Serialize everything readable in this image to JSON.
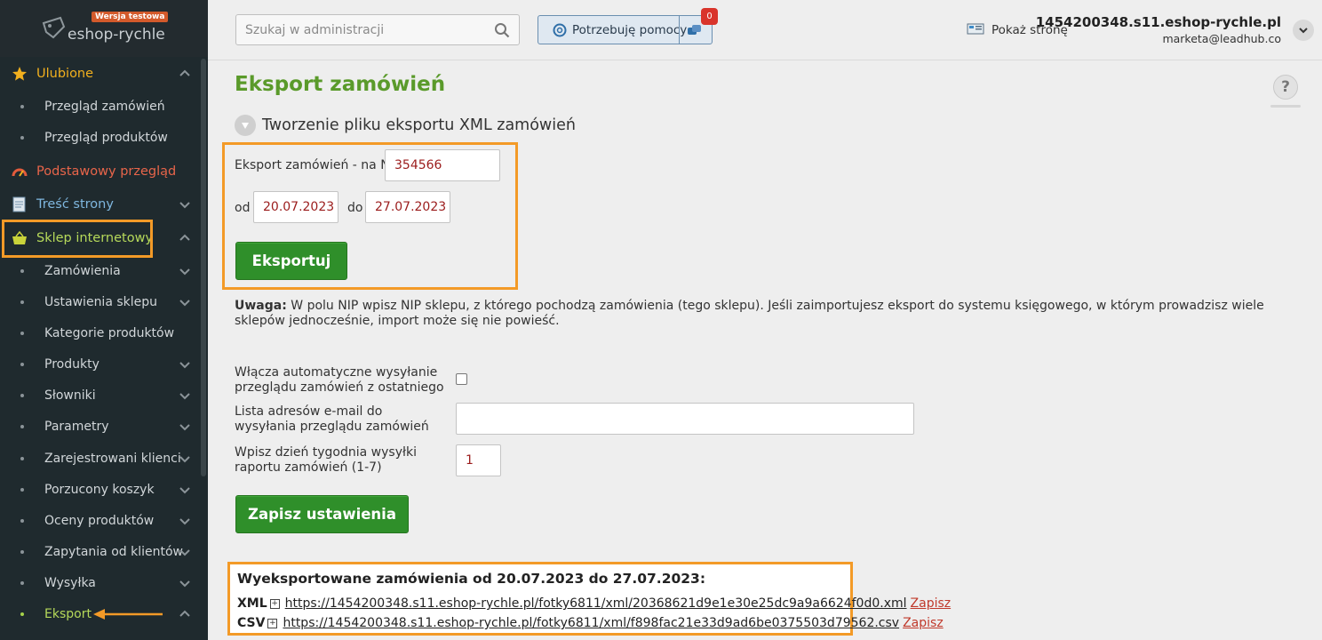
{
  "brand": {
    "name": "eshop-rychle",
    "badge": "Wersja testowa"
  },
  "sidebar": {
    "items": [
      {
        "label": "Ulubione",
        "icon": "star-icon",
        "expanded": true
      },
      {
        "label": "Przegląd zamówień"
      },
      {
        "label": "Przegląd produktów"
      },
      {
        "label": "Podstawowy przegląd",
        "icon": "gauge-icon"
      },
      {
        "label": "Treść strony",
        "icon": "document-icon",
        "expanded": false
      },
      {
        "label": "Sklep internetowy",
        "icon": "basket-icon",
        "expanded": true
      },
      {
        "label": "Zamówienia"
      },
      {
        "label": "Ustawienia sklepu"
      },
      {
        "label": "Kategorie produktów"
      },
      {
        "label": "Produkty"
      },
      {
        "label": "Słowniki"
      },
      {
        "label": "Parametry"
      },
      {
        "label": "Zarejestrowani klienci"
      },
      {
        "label": "Porzucony koszyk"
      },
      {
        "label": "Oceny produktów"
      },
      {
        "label": "Zapytania od klientów"
      },
      {
        "label": "Wysyłka"
      },
      {
        "label": "Eksport",
        "active": true
      }
    ]
  },
  "header": {
    "search_placeholder": "Szukaj w administracji",
    "help_label": "Potrzebuję pomocy",
    "notifications": "0",
    "show_page": "Pokaż stronę",
    "account_host": "1454200348.s11.eshop-rychle.pl",
    "account_email": "marketa@leadhub.co"
  },
  "main": {
    "title": "Eksport zamówień",
    "help_symbol": "?",
    "section_title": "Tworzenie pliku eksportu XML zamówień",
    "nip_label": "Eksport zamówień - na NIP",
    "nip_value": "354566",
    "from_label": "od",
    "from_value": "20.07.2023",
    "to_label": "do",
    "to_value": "27.07.2023",
    "export_button": "Eksportuj",
    "note_bold": "Uwaga:",
    "note_text": " W polu NIP wpisz NIP sklepu, z którego pochodzą zamówienia (tego sklepu). Jeśli zaimportujesz eksport do systemu księgowego, w którym prowadzisz wiele sklepów jednocześnie, import może się nie powieść.",
    "auto_send_label": "Włącza automatyczne wysyłanie przeglądu zamówień z ostatniego",
    "auto_send_checked": false,
    "emails_label": "Lista adresów e-mail do wysyłania przeglądu zamówień",
    "emails_value": "",
    "weekday_label": "Wpisz dzień tygodnia wysyłki raportu zamówień (1-7)",
    "weekday_value": "1",
    "save_button": "Zapisz ustawienia"
  },
  "exported": {
    "heading": "Wyeksportowane zamówienia od 20.07.2023 do 27.07.2023:",
    "files": [
      {
        "format": "XML",
        "url": "https://1454200348.s11.eshop-rychle.pl/fotky6811/xml/20368621d9e1e30e25dc9a9a6624f0d0.xml",
        "save": "Zapisz"
      },
      {
        "format": "CSV",
        "url": "https://1454200348.s11.eshop-rychle.pl/fotky6811/xml/f898fac21e33d9ad6be0375503d79562.csv",
        "save": "Zapisz"
      }
    ]
  },
  "colors": {
    "accent_green": "#5a9a2a",
    "button_green": "#2f8f2a",
    "highlight_orange": "#f39a27",
    "sidebar_bg": "#1f2a2e"
  }
}
